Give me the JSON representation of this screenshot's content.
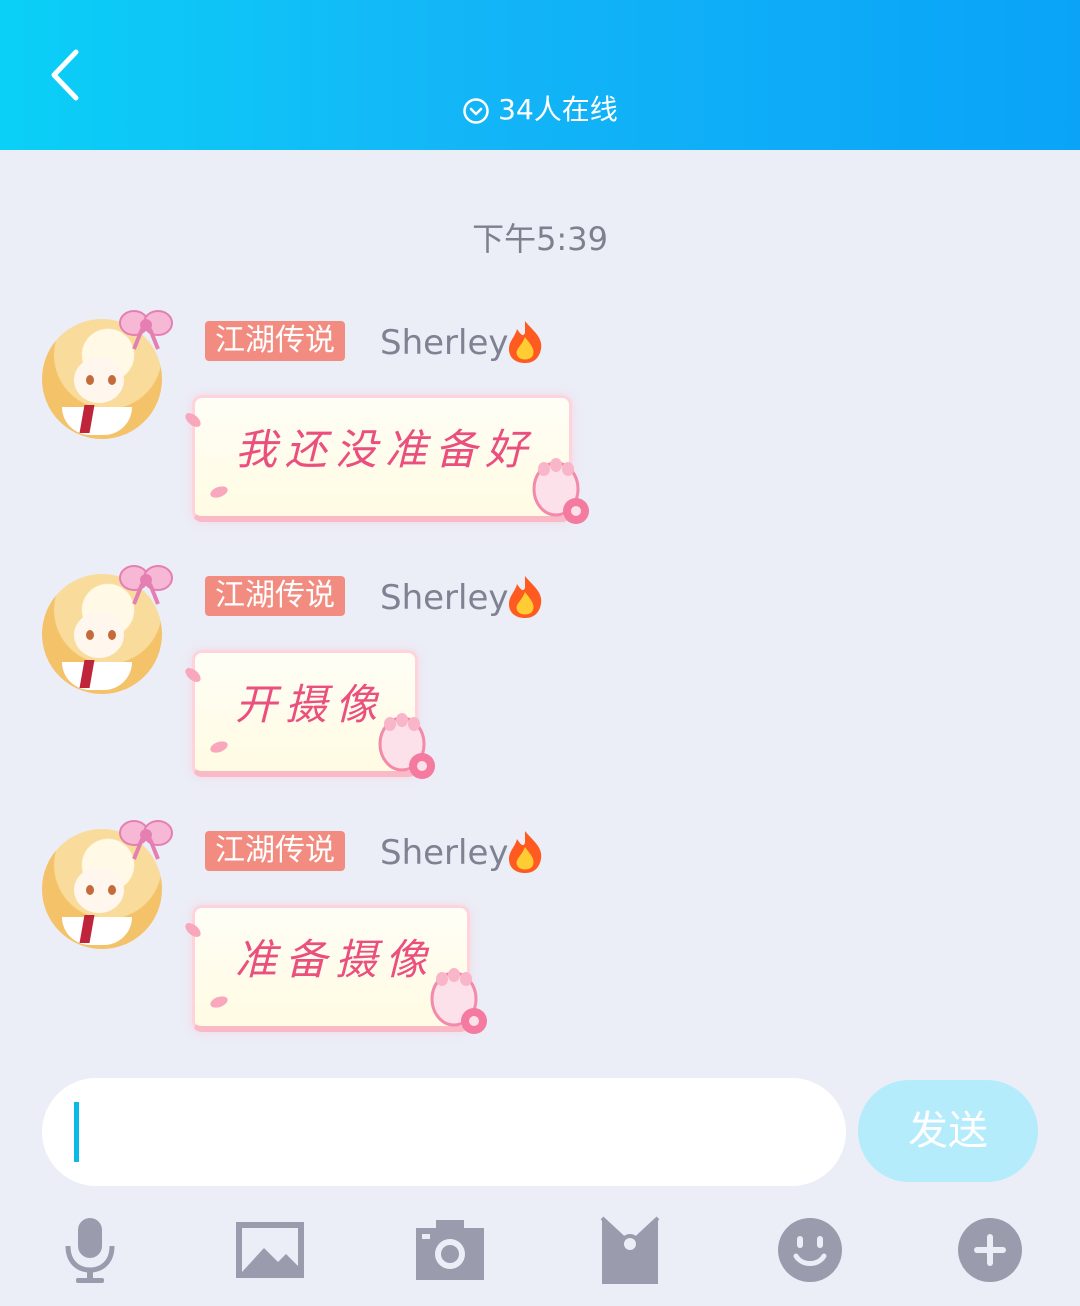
{
  "header": {
    "online_text": "34人在线",
    "background": "#13b7f7"
  },
  "timestamp": "下午5:39",
  "messages": [
    {
      "tag": "江湖传说",
      "name": "Sherley",
      "text": "我还没准备好"
    },
    {
      "tag": "江湖传说",
      "name": "Sherley",
      "text": "开摄像"
    },
    {
      "tag": "江湖传说",
      "name": "Sherley",
      "text": "准备摄像"
    }
  ],
  "input": {
    "value": "",
    "placeholder": ""
  },
  "send_label": "发送",
  "toolbar": [
    {
      "icon": "microphone-icon"
    },
    {
      "icon": "image-icon"
    },
    {
      "icon": "camera-icon"
    },
    {
      "icon": "red-packet-icon"
    },
    {
      "icon": "emoji-icon"
    },
    {
      "icon": "plus-icon"
    }
  ],
  "colors": {
    "tag_bg": "#f28c80",
    "bubble_text": "#ea4f7e",
    "send_bg": "#b5ecfc",
    "icon_gray": "#9a9cae"
  }
}
